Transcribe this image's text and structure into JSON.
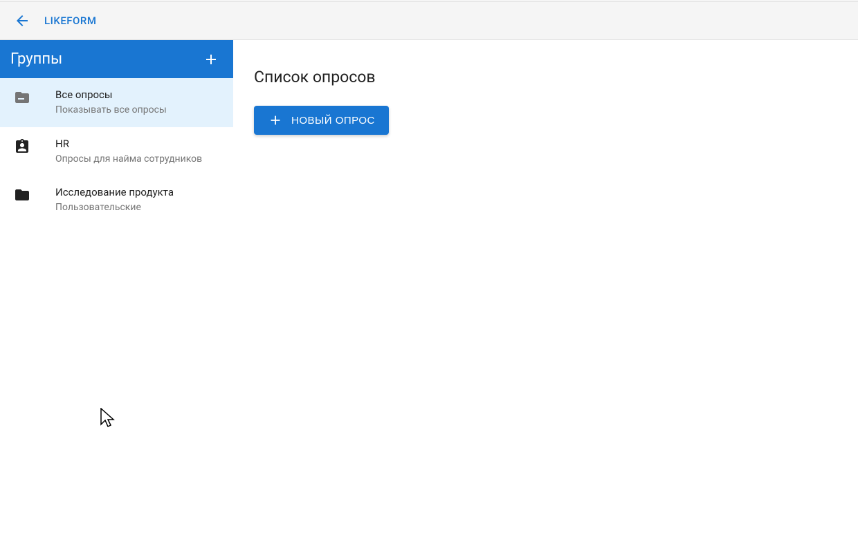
{
  "header": {
    "brand": "LIKEFORM"
  },
  "sidebar": {
    "title": "Группы",
    "items": [
      {
        "title": "Все опросы",
        "subtitle": "Показывать все опросы"
      },
      {
        "title": "HR",
        "subtitle": "Опросы для найма сотрудников"
      },
      {
        "title": "Исследование продукта",
        "subtitle": "Пользовательские"
      }
    ]
  },
  "main": {
    "page_title": "Список опросов",
    "new_survey_button": "НОВЫЙ ОПРОС"
  }
}
